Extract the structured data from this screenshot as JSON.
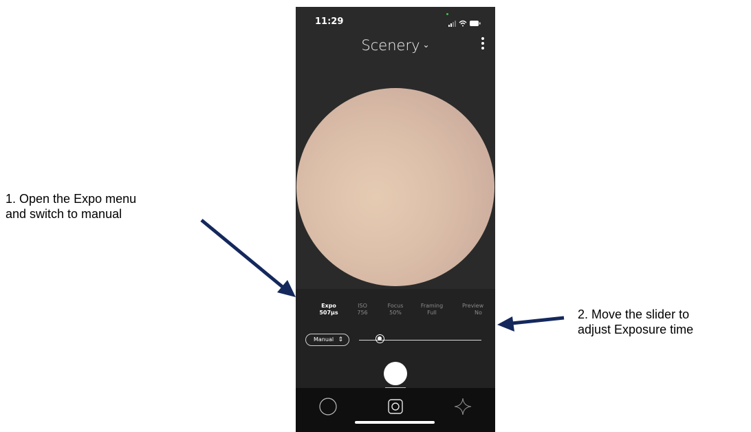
{
  "annotations": [
    {
      "lines": [
        "1. Open the Expo menu",
        "and switch to manual"
      ]
    },
    {
      "lines": [
        "2. Move the slider to",
        "adjust Exposure time"
      ]
    }
  ],
  "status_bar": {
    "time": "11:29",
    "icons": [
      "signal-icon",
      "wifi-icon",
      "battery-icon"
    ]
  },
  "header": {
    "title": "Scenery",
    "title_chevron": "⌄",
    "menu_icon": "more-vertical-icon"
  },
  "params": [
    {
      "label": "Expo",
      "value": "507µs",
      "active": true
    },
    {
      "label": "ISO",
      "value": "756",
      "active": false
    },
    {
      "label": "Focus",
      "value": "50%",
      "active": false
    },
    {
      "label": "Framing",
      "value": "Full",
      "active": false
    },
    {
      "label": "Preview",
      "value": "No",
      "active": false
    }
  ],
  "mode_button": {
    "label": "Manual",
    "icon": "up-down-chevron-icon"
  },
  "exposure_slider": {
    "position_fraction": 0.17
  },
  "tab_bar": {
    "tabs": [
      "circle-icon",
      "camera-icon",
      "sparkle-icon"
    ],
    "selected": "camera-icon"
  },
  "colors": {
    "arrow": "#14285c",
    "phone_bg": "#2a2a2a",
    "preview_skin": "#dcbfa9"
  }
}
